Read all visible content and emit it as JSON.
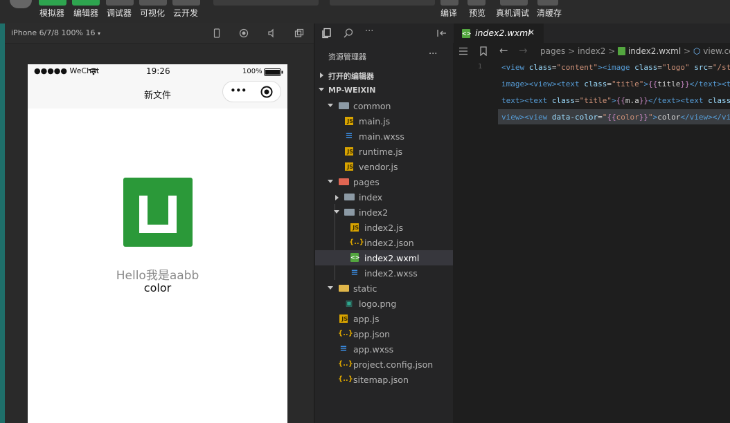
{
  "toolbar": {
    "buttons": [
      {
        "label": "模拟器",
        "color": "#2ea44f"
      },
      {
        "label": "编辑器",
        "color": "#2ea44f"
      },
      {
        "label": "调试器",
        "color": "#555555"
      },
      {
        "label": "可视化",
        "color": "#555555"
      },
      {
        "label": "云开发",
        "color": "#555555"
      }
    ],
    "right_buttons": [
      "编译",
      "预览",
      "真机调试",
      "清缓存"
    ]
  },
  "simulator": {
    "device": "iPhone 6/7/8 100% 16",
    "status": {
      "signal": "●●●●● WeChat",
      "time": "19:26",
      "battery": "100%"
    },
    "nav_title": "新文件",
    "capsule_more": "•••",
    "greeting": "Hello我是aabb",
    "color_text": "color",
    "logo_color": "#2b9939"
  },
  "explorer": {
    "title": "资源管理器",
    "more": "···",
    "open_editors": "打开的编辑器",
    "root": "MP-WEIXIN",
    "items": [
      {
        "label": "common",
        "type": "folder"
      },
      {
        "label": "main.js",
        "type": "js"
      },
      {
        "label": "main.wxss",
        "type": "css"
      },
      {
        "label": "runtime.js",
        "type": "js"
      },
      {
        "label": "vendor.js",
        "type": "js"
      },
      {
        "label": "pages",
        "type": "folder"
      },
      {
        "label": "index",
        "type": "folder"
      },
      {
        "label": "index2",
        "type": "folder"
      },
      {
        "label": "index2.js",
        "type": "js"
      },
      {
        "label": "index2.json",
        "type": "json"
      },
      {
        "label": "index2.wxml",
        "type": "wxml",
        "selected": true
      },
      {
        "label": "index2.wxss",
        "type": "css"
      },
      {
        "label": "static",
        "type": "folder"
      },
      {
        "label": "logo.png",
        "type": "png"
      },
      {
        "label": "app.js",
        "type": "js"
      },
      {
        "label": "app.json",
        "type": "json"
      },
      {
        "label": "app.wxss",
        "type": "css"
      },
      {
        "label": "project.config.json",
        "type": "json"
      },
      {
        "label": "sitemap.json",
        "type": "json"
      }
    ]
  },
  "editor": {
    "tab": "index2.wxml",
    "tab_close": "✕",
    "breadcrumb": [
      "pages",
      "index2",
      "index2.wxml",
      "view.co"
    ],
    "line_number": "1"
  }
}
